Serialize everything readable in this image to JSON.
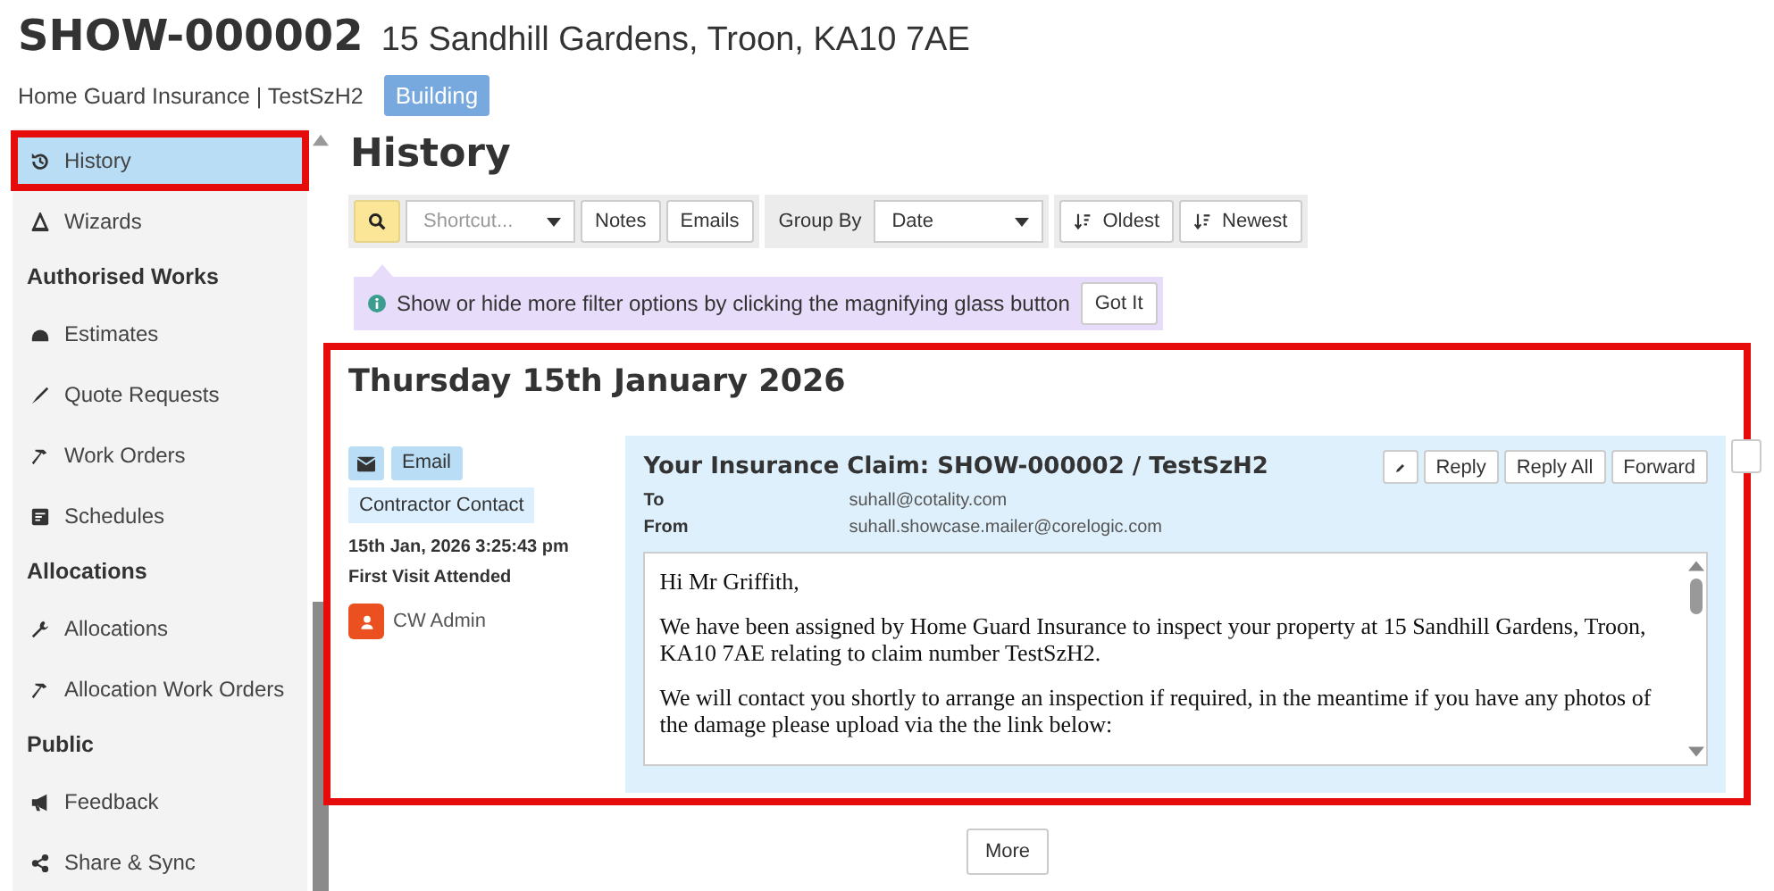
{
  "header": {
    "reference": "SHOW-000002",
    "address": "15 Sandhill Gardens, Troon, KA10 7AE",
    "client": "Home Guard Insurance | TestSzH2",
    "tag": "Building"
  },
  "sidebar": {
    "items": [
      {
        "kind": "item",
        "label": "History",
        "selected": true,
        "highlighted": true
      },
      {
        "kind": "item",
        "label": "Wizards",
        "selected": false,
        "highlighted": false
      },
      {
        "kind": "heading",
        "label": "Authorised Works"
      },
      {
        "kind": "item",
        "label": "Estimates",
        "selected": false,
        "highlighted": false
      },
      {
        "kind": "item",
        "label": "Quote Requests",
        "selected": false,
        "highlighted": false
      },
      {
        "kind": "item",
        "label": "Work Orders",
        "selected": false,
        "highlighted": false
      },
      {
        "kind": "item",
        "label": "Schedules",
        "selected": false,
        "highlighted": false
      },
      {
        "kind": "heading",
        "label": "Allocations"
      },
      {
        "kind": "item",
        "label": "Allocations",
        "selected": false,
        "highlighted": false
      },
      {
        "kind": "item",
        "label": "Allocation Work Orders",
        "selected": false,
        "highlighted": false
      },
      {
        "kind": "heading",
        "label": "Public"
      },
      {
        "kind": "item",
        "label": "Feedback",
        "selected": false,
        "highlighted": false
      },
      {
        "kind": "item",
        "label": "Share & Sync",
        "selected": false,
        "highlighted": false
      }
    ]
  },
  "page_title": "History",
  "toolbar": {
    "search_on": true,
    "shortcut_placeholder": "Shortcut...",
    "filters": [
      "Notes",
      "Emails"
    ],
    "group_by_label": "Group By",
    "group_by_value": "Date",
    "sort_buttons": [
      "Oldest",
      "Newest"
    ]
  },
  "tip": {
    "text": "Show or hide more filter options by clicking the magnifying glass button",
    "button": "Got It"
  },
  "day": {
    "heading": "Thursday 15th January 2026",
    "highlighted": true,
    "event": {
      "type_label": "Email",
      "category": "Contractor Contact",
      "timestamp": "15th Jan, 2026 3:25:43 pm",
      "stage": "First Visit Attended",
      "author": "CW Admin",
      "email": {
        "subject": "Your Insurance Claim: SHOW-000002 / TestSzH2",
        "actions": [
          "Reply",
          "Reply All",
          "Forward"
        ],
        "fields": [
          {
            "label": "To",
            "value": "suhall@cotality.com"
          },
          {
            "label": "From",
            "value": "suhall.showcase.mailer@corelogic.com"
          }
        ],
        "body": [
          "Hi Mr Griffith,",
          "We have been assigned by Home Guard Insurance to inspect your property at 15 Sandhill Gardens, Troon, KA10 7AE relating to claim number TestSzH2.",
          "We will contact you shortly to arrange an inspection if required, in the meantime if you have any photos of the damage please upload via the the link below:"
        ]
      }
    }
  },
  "more_button": "More"
}
